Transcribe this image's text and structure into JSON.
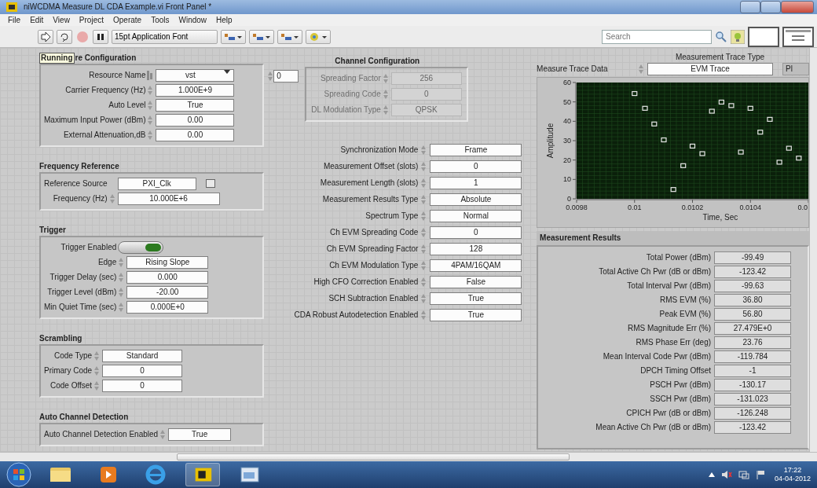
{
  "window": {
    "title": "niWCDMA Measure DL CDA Example.vi Front Panel *"
  },
  "menu": [
    "File",
    "Edit",
    "View",
    "Project",
    "Operate",
    "Tools",
    "Window",
    "Help"
  ],
  "toolbar": {
    "font": "15pt Application Font",
    "search": {
      "placeholder": "Search"
    }
  },
  "tooltip": "Running",
  "left_sections": [
    {
      "title": "re Configuration",
      "controls": [
        {
          "kind": "io",
          "label": "Resource Name",
          "value": "vst"
        },
        {
          "kind": "spin",
          "label": "Carrier Frequency (Hz)",
          "value": "1.000E+9"
        },
        {
          "kind": "spin",
          "label": "Auto Level",
          "value": "True"
        },
        {
          "kind": "spin",
          "label": "Maximum Input Power (dBm)",
          "value": "0.00"
        },
        {
          "kind": "spin",
          "label": "External Attenuation,dB",
          "value": "0.00"
        }
      ]
    },
    {
      "title": "Frequency Reference",
      "controls": [
        {
          "kind": "browse",
          "label": "Reference Source",
          "value": "PXI_Clk"
        },
        {
          "kind": "spin",
          "label": "Frequency (Hz)",
          "value": "10.000E+6"
        }
      ]
    },
    {
      "title": "Trigger",
      "controls": [
        {
          "kind": "toggle",
          "label": "Trigger Enabled",
          "on": true
        },
        {
          "kind": "spin",
          "label": "Edge",
          "value": "Rising Slope"
        },
        {
          "kind": "spin",
          "label": "Trigger Delay (sec)",
          "value": "0.000"
        },
        {
          "kind": "spin",
          "label": "Trigger Level (dBm)",
          "value": "-20.00"
        },
        {
          "kind": "spin",
          "label": "Min Quiet Time (sec)",
          "value": "0.000E+0"
        }
      ]
    },
    {
      "title": "Scrambling",
      "controls": [
        {
          "kind": "spin",
          "label": "Code Type",
          "value": "Standard"
        },
        {
          "kind": "spin",
          "label": "Primary Code",
          "value": "0"
        },
        {
          "kind": "spin",
          "label": "Code Offset",
          "value": "0"
        }
      ]
    },
    {
      "title": "Auto Channel Detection",
      "controls": [
        {
          "kind": "spin",
          "label": "Auto Channel Detection Enabled",
          "value": "True"
        }
      ]
    }
  ],
  "channel_configuration": {
    "title": "Channel Configuration",
    "index": "0",
    "cluster": {
      "disabled": true,
      "controls": [
        {
          "label": "Spreading Factor",
          "value": "256"
        },
        {
          "label": "Spreading Code",
          "value": "0"
        },
        {
          "label": "DL Modulation Type",
          "value": "QPSK"
        }
      ]
    }
  },
  "middle_controls": [
    {
      "label": "Synchronization Mode",
      "value": "Frame"
    },
    {
      "label": "Measurement Offset (slots)",
      "value": "0"
    },
    {
      "label": "Measurement Length (slots)",
      "value": "1"
    },
    {
      "label": "Measurement Results Type",
      "value": "Absolute"
    },
    {
      "label": "Spectrum Type",
      "value": "Normal"
    },
    {
      "label": "Ch EVM Spreading Code",
      "value": "0"
    },
    {
      "label": "Ch EVM Spreading Factor",
      "value": "128"
    },
    {
      "label": "Ch EVM Modulation Type",
      "value": "4PAM/16QAM"
    },
    {
      "label": "High CFO Correction Enabled",
      "value": "False"
    },
    {
      "label": "SCH Subtraction Enabled",
      "value": "True"
    },
    {
      "label": "CDA Robust Autodetection Enabled",
      "value": "True"
    }
  ],
  "trace_type": {
    "label": "Measurement Trace Type",
    "value": "EVM Trace",
    "next_item": "Pl"
  },
  "graph": {
    "label": "Measure Trace Data",
    "chart_data": {
      "type": "scatter",
      "xlabel": "Time, Sec",
      "ylabel": "Amplitude",
      "x": [
        0.01,
        0.010036,
        0.010068,
        0.010101,
        0.010134,
        0.010168,
        0.0102,
        0.010234,
        0.010267,
        0.0103,
        0.010334,
        0.010367,
        0.0104,
        0.010434,
        0.010467,
        0.0105,
        0.010533,
        0.010567
      ],
      "series": [
        {
          "color": "#e6e6e6",
          "values": [
            54.3,
            46.7,
            38.6,
            30.4,
            4.8,
            17.1,
            27.2,
            23.3,
            45.2,
            49.9,
            48.1,
            24.1,
            46.7,
            34.4,
            41.0,
            18.9,
            26.1,
            21.0
          ]
        }
      ],
      "grid": true,
      "xlim": [
        0.0098,
        0.0106
      ],
      "ylim": [
        0,
        60
      ],
      "xticks": [
        0.0098,
        0.01,
        0.0102,
        0.0104,
        {
          "value": 0.0106,
          "label": "0.0"
        }
      ],
      "yticks": [
        0,
        10,
        20,
        30,
        40,
        50,
        60
      ]
    }
  },
  "results": {
    "title": "Measurement Results",
    "rows": [
      {
        "label": "Total Power (dBm)",
        "value": "-99.49"
      },
      {
        "label": "Total Active Ch Pwr (dB or dBm)",
        "value": "-123.42"
      },
      {
        "label": "Total Interval Pwr (dBm)",
        "value": "-99.63"
      },
      {
        "label": "RMS EVM (%)",
        "value": "36.80"
      },
      {
        "label": "Peak EVM (%)",
        "value": "56.80"
      },
      {
        "label": "RMS Magnitude Err (%)",
        "value": "27.479E+0"
      },
      {
        "label": "RMS Phase Err (deg)",
        "value": "23.76"
      },
      {
        "label": "Mean Interval Code Pwr (dBm)",
        "value": "-119.784"
      },
      {
        "label": "DPCH Timing Offset",
        "value": "-1"
      },
      {
        "label": "PSCH Pwr (dBm)",
        "value": "-130.17"
      },
      {
        "label": "SSCH Pwr (dBm)",
        "value": "-131.023"
      },
      {
        "label": "CPICH Pwr (dB or dBm)",
        "value": "-126.248"
      },
      {
        "label": "Mean Active Ch Pwr (dB or dBm)",
        "value": "-123.42"
      }
    ]
  },
  "taskbar": {
    "time": "17:22",
    "date": "04-04-2012"
  }
}
